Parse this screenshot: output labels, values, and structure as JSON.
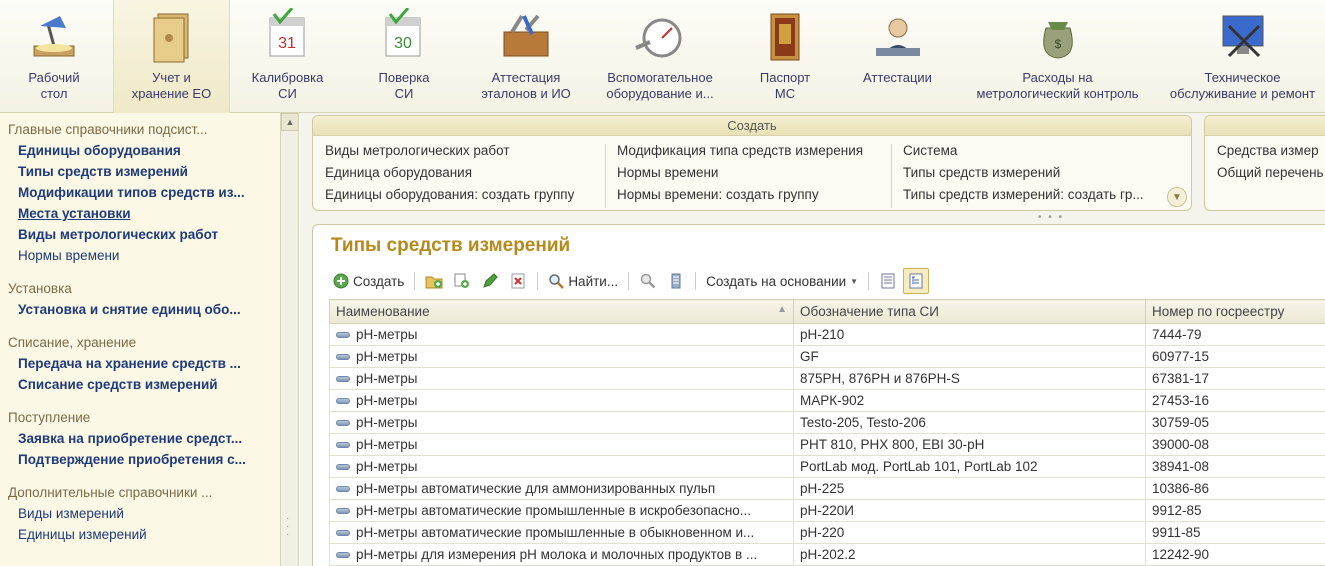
{
  "toolbar": {
    "items": [
      {
        "label1": "Рабочий",
        "label2": "стол",
        "icon": "desk-lamp-icon"
      },
      {
        "label1": "Учет и",
        "label2": "хранение ЕО",
        "icon": "binder-icon"
      },
      {
        "label1": "Калибровка",
        "label2": "СИ",
        "icon": "calendar-31-icon"
      },
      {
        "label1": "Поверка",
        "label2": "СИ",
        "icon": "calendar-30-icon"
      },
      {
        "label1": "Аттестация",
        "label2": "эталонов и ИО",
        "icon": "toolbox-icon"
      },
      {
        "label1": "Вспомогательное",
        "label2": "оборудование и...",
        "icon": "gauge-icon"
      },
      {
        "label1": "Паспорт",
        "label2": "МС",
        "icon": "scroll-icon"
      },
      {
        "label1": "Аттестации",
        "label2": "",
        "icon": "person-desk-icon"
      },
      {
        "label1": "Расходы на",
        "label2": "метрологический контроль",
        "icon": "money-bag-icon"
      },
      {
        "label1": "Техническое",
        "label2": "обслуживание и ремонт",
        "icon": "monitor-tools-icon"
      }
    ]
  },
  "sidebar": {
    "groups": [
      {
        "title": "Главные справочники подсист...",
        "items": [
          {
            "label": "Единицы оборудования",
            "style": "bold"
          },
          {
            "label": "Типы средств измерений",
            "style": "bold"
          },
          {
            "label": "Модификации типов средств из...",
            "style": "bold"
          },
          {
            "label": "Места установки",
            "style": "bold-underline"
          },
          {
            "label": "Виды метрологических работ",
            "style": "bold"
          },
          {
            "label": "Нормы времени",
            "style": "plain"
          }
        ]
      },
      {
        "title": "Установка",
        "items": [
          {
            "label": "Установка и снятие единиц обо...",
            "style": "bold"
          }
        ]
      },
      {
        "title": "Списание, хранение",
        "items": [
          {
            "label": "Передача на хранение средств ...",
            "style": "bold"
          },
          {
            "label": "Списание средств измерений",
            "style": "bold"
          }
        ]
      },
      {
        "title": "Поступление",
        "items": [
          {
            "label": "Заявка на приобретение средст...",
            "style": "bold"
          },
          {
            "label": "Подтверждение приобретения с...",
            "style": "bold"
          }
        ]
      },
      {
        "title": "Дополнительные справочники ...",
        "items": [
          {
            "label": "Виды измерений",
            "style": "plain"
          },
          {
            "label": "Единицы измерений",
            "style": "plain"
          }
        ]
      }
    ]
  },
  "create_panel": {
    "header": "Создать",
    "columns": [
      [
        "Виды метрологических работ",
        "Единица оборудования",
        "Единицы оборудования: создать группу"
      ],
      [
        "Модификация типа средств измерения",
        "Нормы времени",
        "Нормы времени: создать группу"
      ],
      [
        "Система",
        "Типы средств измерений",
        "Типы средств измерений: создать гр..."
      ]
    ]
  },
  "create_panel2": {
    "header": "С",
    "items": [
      "Средства измер",
      "Общий перечень"
    ]
  },
  "list": {
    "title": "Типы средств измерений",
    "commands": {
      "create": "Создать",
      "find": "Найти...",
      "create_based_on": "Создать на основании"
    },
    "columns": [
      "Наименование",
      "Обозначение типа СИ",
      "Номер по госреестру"
    ],
    "rows": [
      [
        "pH-метры",
        "pH-210",
        "7444-79"
      ],
      [
        "pH-метры",
        "GF",
        "60977-15"
      ],
      [
        "pH-метры",
        "875PH, 876PH и 876PH-S",
        "67381-17"
      ],
      [
        "pH-метры",
        "МАРК-902",
        "27453-16"
      ],
      [
        "pH-метры",
        "Testo-205, Testo-206",
        "30759-05"
      ],
      [
        "pH-метры",
        "PHT 810, PHX 800, EBI 30-pH",
        "39000-08"
      ],
      [
        "pH-метры",
        "PortLab мод. PortLab 101, PortLab 102",
        "38941-08"
      ],
      [
        "pH-метры автоматические для аммонизированных пульп",
        "pH-225",
        "10386-86"
      ],
      [
        "pH-метры автоматические промышленные в искробезопасно...",
        "pH-220И",
        "9912-85"
      ],
      [
        "pH-метры автоматические промышленные в обыкновенном и...",
        "pH-220",
        "9911-85"
      ],
      [
        "pH-метры для измерения pH молока и молочных продуктов в ...",
        "pH-202.2",
        "12242-90"
      ]
    ]
  }
}
